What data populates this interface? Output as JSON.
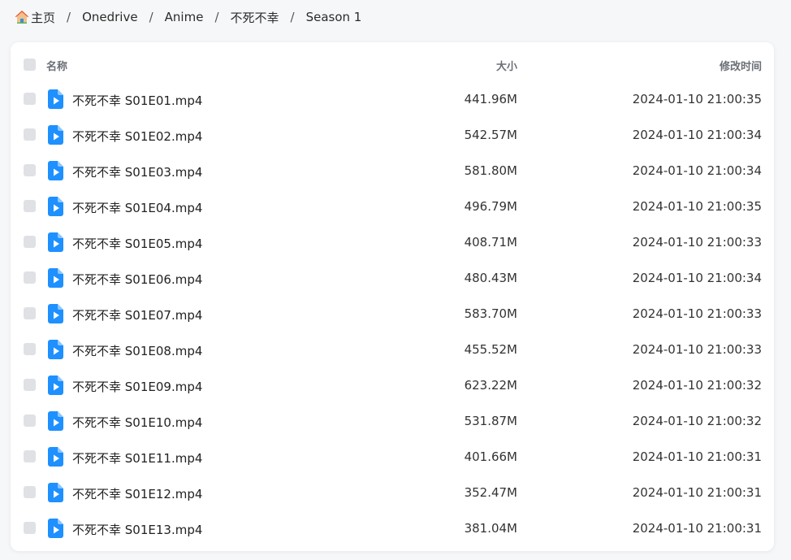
{
  "breadcrumb": {
    "items": [
      "主页",
      "Onedrive",
      "Anime",
      "不死不幸",
      "Season 1"
    ],
    "separator": "/"
  },
  "table": {
    "columns": {
      "name": "名称",
      "size": "大小",
      "modified": "修改时间"
    },
    "rows": [
      {
        "name": "不死不幸 S01E01.mp4",
        "size": "441.96M",
        "modified": "2024-01-10 21:00:35"
      },
      {
        "name": "不死不幸 S01E02.mp4",
        "size": "542.57M",
        "modified": "2024-01-10 21:00:34"
      },
      {
        "name": "不死不幸 S01E03.mp4",
        "size": "581.80M",
        "modified": "2024-01-10 21:00:34"
      },
      {
        "name": "不死不幸 S01E04.mp4",
        "size": "496.79M",
        "modified": "2024-01-10 21:00:35"
      },
      {
        "name": "不死不幸 S01E05.mp4",
        "size": "408.71M",
        "modified": "2024-01-10 21:00:33"
      },
      {
        "name": "不死不幸 S01E06.mp4",
        "size": "480.43M",
        "modified": "2024-01-10 21:00:34"
      },
      {
        "name": "不死不幸 S01E07.mp4",
        "size": "583.70M",
        "modified": "2024-01-10 21:00:33"
      },
      {
        "name": "不死不幸 S01E08.mp4",
        "size": "455.52M",
        "modified": "2024-01-10 21:00:33"
      },
      {
        "name": "不死不幸 S01E09.mp4",
        "size": "623.22M",
        "modified": "2024-01-10 21:00:32"
      },
      {
        "name": "不死不幸 S01E10.mp4",
        "size": "531.87M",
        "modified": "2024-01-10 21:00:32"
      },
      {
        "name": "不死不幸 S01E11.mp4",
        "size": "401.66M",
        "modified": "2024-01-10 21:00:31"
      },
      {
        "name": "不死不幸 S01E12.mp4",
        "size": "352.47M",
        "modified": "2024-01-10 21:00:31"
      },
      {
        "name": "不死不幸 S01E13.mp4",
        "size": "381.04M",
        "modified": "2024-01-10 21:00:31"
      }
    ]
  },
  "icons": {
    "home": "home-icon",
    "file": "video-file-icon"
  },
  "colors": {
    "accent": "#1e90ff",
    "background": "#f6f7f9",
    "checkbox": "#dfe1e5"
  }
}
